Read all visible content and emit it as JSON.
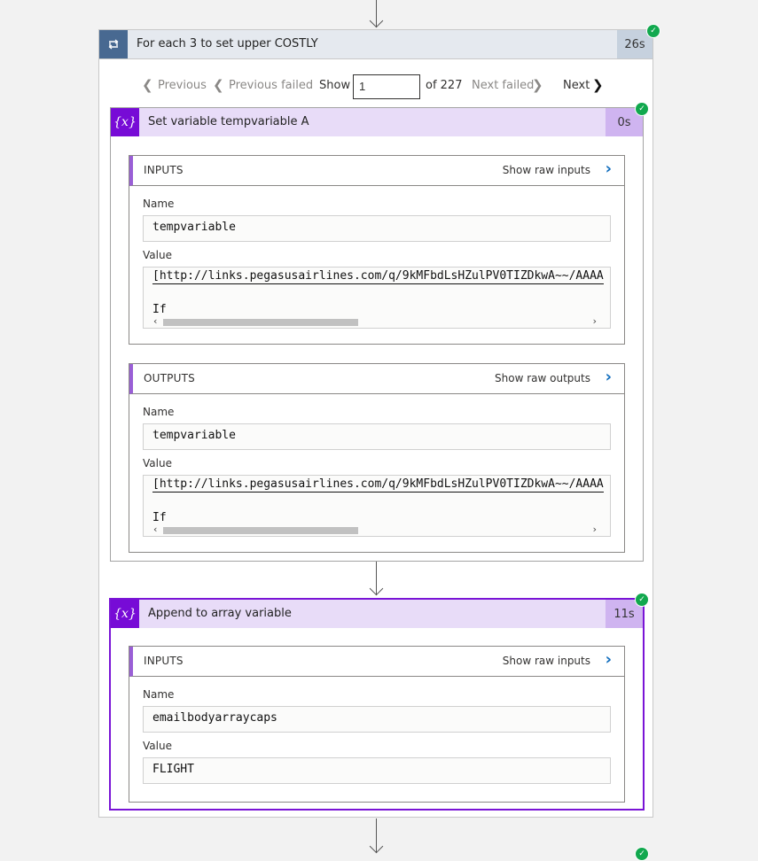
{
  "foreach": {
    "title": "For each 3 to set upper COSTLY",
    "duration": "26s",
    "pager": {
      "previous": "Previous",
      "previous_failed": "Previous failed",
      "show": "Show",
      "current": "1",
      "of": "of 227",
      "next_failed": "Next failed",
      "next": "Next"
    }
  },
  "set_variable": {
    "title": "Set variable tempvariable A",
    "duration": "0s",
    "inputs": {
      "label": "INPUTS",
      "raw": "Show raw inputs",
      "name_label": "Name",
      "name_value": "tempvariable",
      "value_label": "Value",
      "value_line1": "[http://links.pegasusairlines.com/q/9kMFbdLsHZulPV0TIZDkwA~~/AAAA",
      "value_line2": "If"
    },
    "outputs": {
      "label": "OUTPUTS",
      "raw": "Show raw outputs",
      "name_label": "Name",
      "name_value": "tempvariable",
      "value_label": "Value",
      "value_line1": "[http://links.pegasusairlines.com/q/9kMFbdLsHZulPV0TIZDkwA~~/AAAA",
      "value_line2": "If"
    }
  },
  "append": {
    "title": "Append to array variable",
    "duration": "11s",
    "inputs": {
      "label": "INPUTS",
      "raw": "Show raw inputs",
      "name_label": "Name",
      "name_value": "emailbodyarraycaps",
      "value_label": "Value",
      "value_value": "FLIGHT"
    }
  },
  "icons": {
    "foreach": "loop-icon",
    "variable": "variable-icon",
    "success": "success-check-icon",
    "expand": "chevron-right-icon"
  },
  "colors": {
    "foreach_accent": "#486991",
    "variable_accent": "#770bd6",
    "success": "#11a84e",
    "link_chevron": "#0f6cbd"
  }
}
